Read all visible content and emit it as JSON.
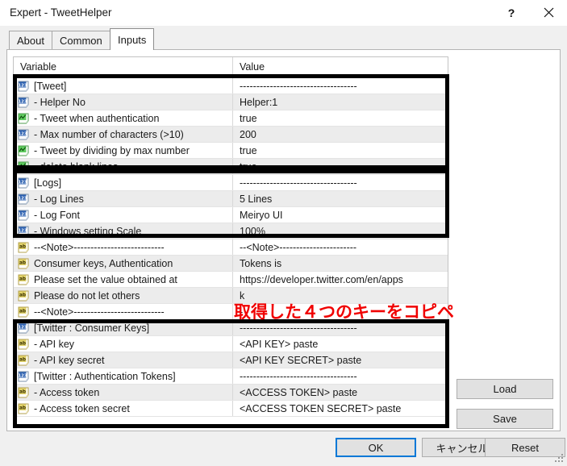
{
  "window": {
    "title": "Expert - TweetHelper",
    "help_icon": "question-mark-icon",
    "help_label": "?",
    "close_icon": "close-icon"
  },
  "tabs": [
    {
      "label": "About",
      "selected": false
    },
    {
      "label": "Common",
      "selected": false
    },
    {
      "label": "Inputs",
      "selected": true
    }
  ],
  "grid": {
    "columns": [
      "Variable",
      "Value"
    ],
    "rows": [
      {
        "icon": "number-type-icon",
        "variable": "[Tweet]",
        "value": "-----------------------------------"
      },
      {
        "icon": "number-type-icon",
        "variable": "- Helper No",
        "value": "Helper:1"
      },
      {
        "icon": "bool-type-icon",
        "variable": "- Tweet when authentication",
        "value": "true"
      },
      {
        "icon": "number-type-icon",
        "variable": "- Max number of characters (>10)",
        "value": "200"
      },
      {
        "icon": "bool-type-icon",
        "variable": "- Tweet by dividing by max number",
        "value": "true"
      },
      {
        "icon": "bool-type-icon",
        "variable": "- delete blank lines",
        "value": "true"
      },
      {
        "icon": "number-type-icon",
        "variable": "[Logs]",
        "value": "-----------------------------------"
      },
      {
        "icon": "number-type-icon",
        "variable": "- Log Lines",
        "value": "5 Lines"
      },
      {
        "icon": "number-type-icon",
        "variable": "- Log Font",
        "value": "Meiryo UI"
      },
      {
        "icon": "number-type-icon",
        "variable": "- Windows setting Scale",
        "value": "100%"
      },
      {
        "icon": "string-type-icon",
        "variable": "--<Note>---------------------------",
        "value": "--<Note>-----------------------"
      },
      {
        "icon": "string-type-icon",
        "variable": "Consumer keys, Authentication",
        "value": "Tokens is"
      },
      {
        "icon": "string-type-icon",
        "variable": "Please set the value obtained at",
        "value": "https://developer.twitter.com/en/apps"
      },
      {
        "icon": "string-type-icon",
        "variable": "Please do not let others",
        "value": "k"
      },
      {
        "icon": "string-type-icon",
        "variable": "--<Note>---------------------------",
        "value": "-"
      },
      {
        "icon": "number-type-icon",
        "variable": "[Twitter : Consumer Keys]",
        "value": "-----------------------------------"
      },
      {
        "icon": "string-type-icon",
        "variable": "- API key",
        "value": "<API KEY> paste"
      },
      {
        "icon": "string-type-icon",
        "variable": "- API key secret",
        "value": "<API KEY SECRET> paste"
      },
      {
        "icon": "number-type-icon",
        "variable": "[Twitter : Authentication Tokens]",
        "value": "-----------------------------------"
      },
      {
        "icon": "string-type-icon",
        "variable": "- Access token",
        "value": "<ACCESS TOKEN> paste"
      },
      {
        "icon": "string-type-icon",
        "variable": "- Access token secret",
        "value": "<ACCESS TOKEN SECRET> paste"
      }
    ]
  },
  "annotation": {
    "text": "取得した４つのキーをコピペ",
    "color": "#f00000"
  },
  "side_buttons": {
    "load": "Load",
    "save": "Save"
  },
  "bottom_buttons": {
    "ok": "OK",
    "cancel": "キャンセル",
    "reset": "Reset"
  }
}
